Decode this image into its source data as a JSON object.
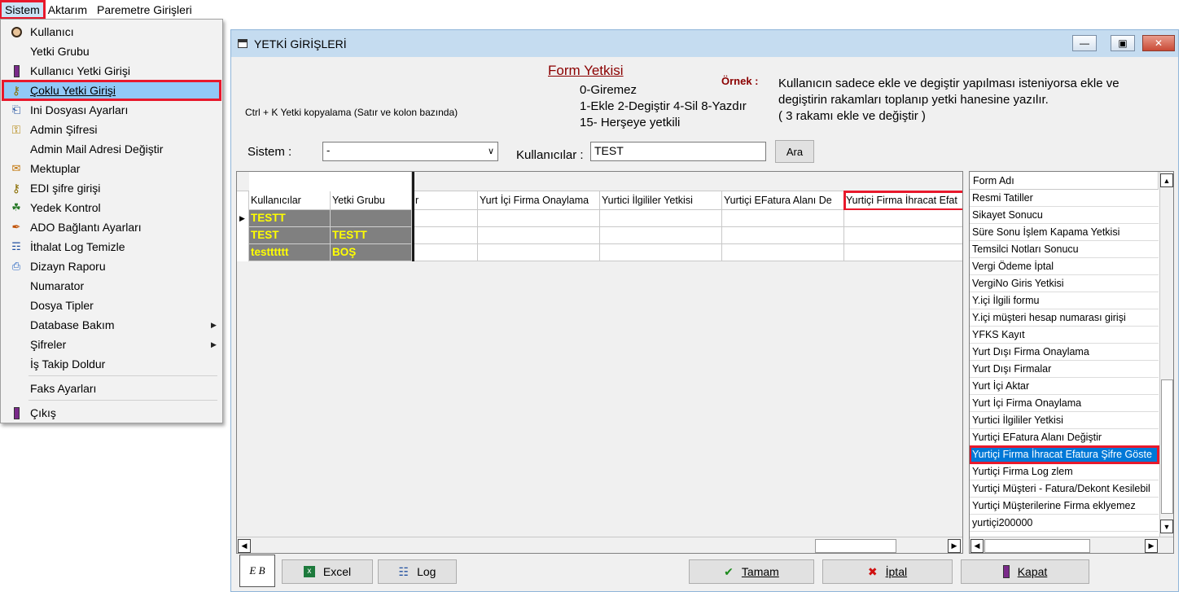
{
  "menubar": {
    "items": [
      "Sistem",
      "Aktarım",
      "Paremetre Girişleri"
    ]
  },
  "popup": {
    "items": [
      {
        "label": "Kullanıcı",
        "icon": "user-icon"
      },
      {
        "label": "Yetki Grubu",
        "icon": ""
      },
      {
        "label": "Kullanıcı Yetki Girişi",
        "icon": "door-exit-icon"
      },
      {
        "label": "Çoklu Yetki Girişi",
        "icon": "keys-icon"
      },
      {
        "label": "Ini Dosyası  Ayarları",
        "icon": "ini-file-icon"
      },
      {
        "label": "Admin Şifresi",
        "icon": "key-icon"
      },
      {
        "label": "Admin Mail Adresi Değiştir",
        "icon": ""
      },
      {
        "label": "Mektuplar",
        "icon": "letters-icon"
      },
      {
        "label": "EDI şifre girişi",
        "icon": "keys-icon"
      },
      {
        "label": "Yedek Kontrol",
        "icon": "backup-icon"
      },
      {
        "label": "ADO Bağlantı Ayarları",
        "icon": "connection-icon"
      },
      {
        "label": "İthalat Log Temizle",
        "icon": "clean-log-icon"
      },
      {
        "label": "Dizayn Raporu",
        "icon": "report-design-icon"
      },
      {
        "label": "Numarator",
        "icon": ""
      },
      {
        "label": "Dosya Tipler",
        "icon": ""
      },
      {
        "label": "Database Bakım",
        "icon": ""
      },
      {
        "label": "Şifreler",
        "icon": ""
      },
      {
        "label": "İş Takip Doldur",
        "icon": ""
      },
      {
        "label": "Faks Ayarları",
        "icon": ""
      },
      {
        "label": "Çıkış",
        "icon": "door-exit-icon"
      }
    ]
  },
  "window": {
    "title": "YETKİ GİRİŞLERİ",
    "form_title": "Form Yetkisi",
    "codes": [
      "0-Giremez",
      "1-Ekle  2-Degiştir  4-Sil  8-Yazdır",
      "15- Herşeye yetkili"
    ],
    "ornek_label": "Örnek :",
    "explain": [
      "Kullanıcın sadece ekle ve degiştir yapılması isteniyorsa  ekle ve",
      "degiştirin rakamları toplanıp yetki hanesine yazılır.",
      " ( 3 rakamı ekle ve değiştir )"
    ],
    "ctrl_k_hint": "Ctrl + K Yetki kopyalama (Satır ve kolon bazında)",
    "sistem_label": "Sistem :",
    "sistem_value": "-",
    "kullanicilar_label": "Kullanıcılar :",
    "kullanicilar_value": "TEST",
    "ara_label": "Ara"
  },
  "grid": {
    "columns": [
      "Kullanıcılar",
      "Yetki Grubu",
      "r",
      "Yurt İçi Firma Onaylama",
      "Yurtici İlgililer Yetkisi",
      "Yurtiçi EFatura Alanı De",
      "Yurtiçi Firma İhracat Efat"
    ],
    "rows": [
      [
        "TESTT",
        "",
        "",
        "",
        "",
        "",
        ""
      ],
      [
        "TEST",
        "TESTT",
        "",
        "",
        "",
        "",
        ""
      ],
      [
        "testttttt",
        "BOŞ",
        "",
        "",
        "",
        "",
        ""
      ]
    ]
  },
  "list": {
    "header": "Form Adı",
    "items": [
      "Resmi Tatiller",
      "Sikayet Sonucu",
      "Süre Sonu İşlem Kapama Yetkisi",
      "Temsilci Notları Sonucu",
      "Vergi Ödeme İptal",
      "VergiNo Giris Yetkisi",
      "Y.içi İlgili formu",
      "Y.içi müşteri hesap numarası girişi",
      "YFKS Kayıt",
      "Yurt Dışı Firma Onaylama",
      "Yurt Dışı Firmalar",
      "Yurt İçi Aktar",
      "Yurt İçi Firma Onaylama",
      "Yurtici İlgililer Yetkisi",
      "Yurtiçi EFatura Alanı Değiştir",
      "Yurtiçi Firma İhracat Efatura Şifre Göste",
      "Yurtiçi Firma Log zlem",
      "Yurtiçi Müşteri - Fatura/Dekont Kesilebil",
      "Yurtiçi Müşterilerine Firma eklyemez",
      "yurtiçi200000"
    ]
  },
  "buttons": {
    "excel": "Excel",
    "log": "Log",
    "tamam": "Tamam",
    "iptal": "İptal",
    "kapat": "Kapat",
    "logo": "E B"
  },
  "colors": {
    "highlight_red": "#e8192c",
    "selection_blue": "#0078d7",
    "grid_fixed_bg": "#808080",
    "grid_fixed_text": "#ffff00"
  }
}
